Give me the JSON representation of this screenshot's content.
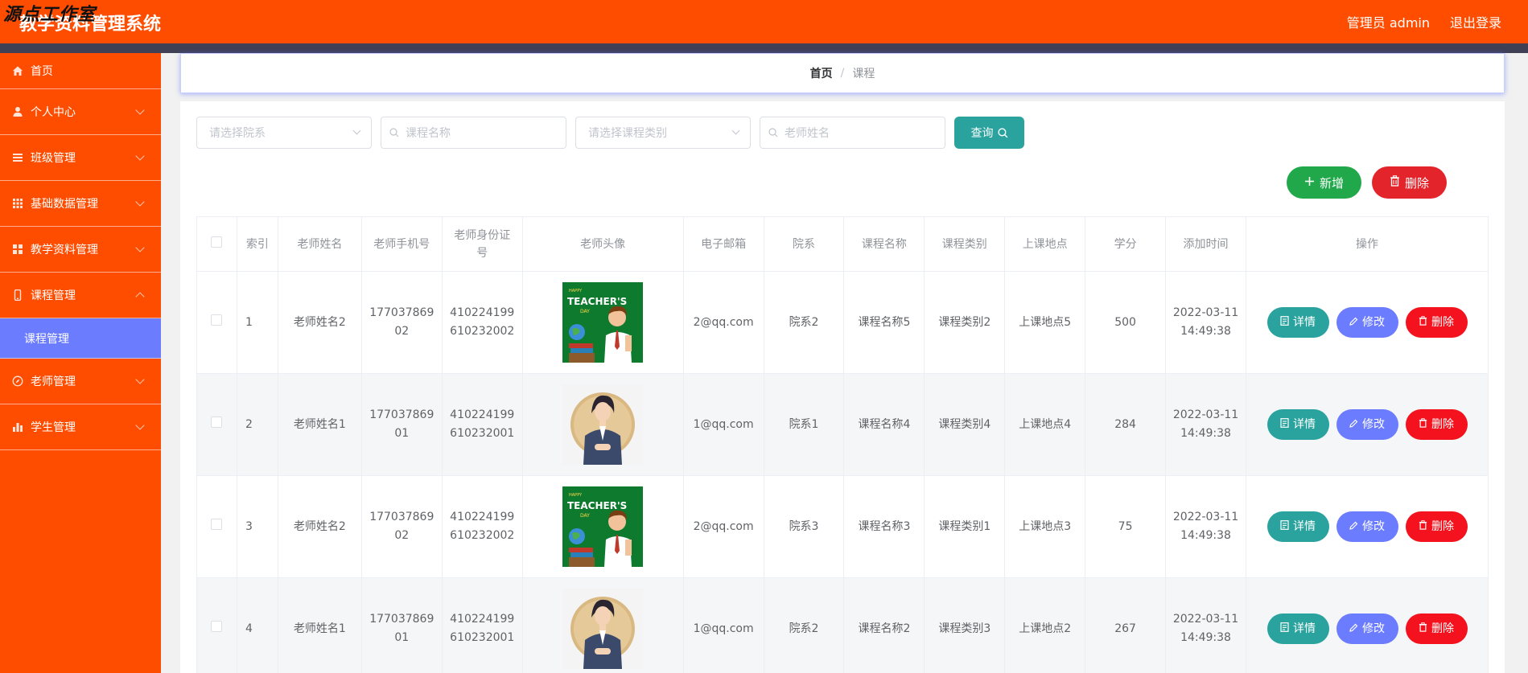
{
  "header": {
    "watermark": "源点工作室",
    "title": "教学资料管理系统",
    "user": "管理员 admin",
    "logout": "退出登录"
  },
  "sidebar": {
    "items": [
      {
        "label": "首页",
        "icon": "home-icon"
      },
      {
        "label": "个人中心",
        "icon": "user-icon"
      },
      {
        "label": "班级管理",
        "icon": "list-icon"
      },
      {
        "label": "基础数据管理",
        "icon": "grid-icon"
      },
      {
        "label": "教学资料管理",
        "icon": "apps-icon"
      },
      {
        "label": "课程管理",
        "icon": "phone-icon"
      },
      {
        "label": "老师管理",
        "icon": "compass-icon"
      },
      {
        "label": "学生管理",
        "icon": "bar-chart-icon"
      }
    ],
    "active_sub": "课程管理"
  },
  "breadcrumb": {
    "home": "首页",
    "separator": "/",
    "current": "课程"
  },
  "search": {
    "department_placeholder": "请选择院系",
    "course_name_placeholder": "课程名称",
    "course_type_placeholder": "请选择课程类别",
    "teacher_name_placeholder": "老师姓名",
    "query_label": "查询"
  },
  "actions": {
    "add_label": "新增",
    "delete_label": "删除"
  },
  "table": {
    "headers": [
      "索引",
      "老师姓名",
      "老师手机号",
      "老师身份证号",
      "老师头像",
      "电子邮箱",
      "院系",
      "课程名称",
      "课程类别",
      "上课地点",
      "学分",
      "添加时间",
      "操作"
    ],
    "header_id_lines": [
      "老师身份证",
      "号"
    ],
    "rows": [
      {
        "index": "1",
        "teacher": "老师姓名2",
        "phone_1": "177037869",
        "phone_2": "02",
        "id_1": "410224199",
        "id_2": "610232002",
        "avatar": "teachers-day-poster",
        "email": "2@qq.com",
        "dept": "院系2",
        "course": "课程名称5",
        "type": "课程类别2",
        "place": "上课地点5",
        "credit": "500",
        "date": "2022-03-11",
        "time": "14:49:38"
      },
      {
        "index": "2",
        "teacher": "老师姓名1",
        "phone_1": "177037869",
        "phone_2": "01",
        "id_1": "410224199",
        "id_2": "610232001",
        "avatar": "woman-teacher-portrait",
        "email": "1@qq.com",
        "dept": "院系1",
        "course": "课程名称4",
        "type": "课程类别4",
        "place": "上课地点4",
        "credit": "284",
        "date": "2022-03-11",
        "time": "14:49:38"
      },
      {
        "index": "3",
        "teacher": "老师姓名2",
        "phone_1": "177037869",
        "phone_2": "02",
        "id_1": "410224199",
        "id_2": "610232002",
        "avatar": "teachers-day-poster",
        "email": "2@qq.com",
        "dept": "院系3",
        "course": "课程名称3",
        "type": "课程类别1",
        "place": "上课地点3",
        "credit": "75",
        "date": "2022-03-11",
        "time": "14:49:38"
      },
      {
        "index": "4",
        "teacher": "老师姓名1",
        "phone_1": "177037869",
        "phone_2": "01",
        "id_1": "410224199",
        "id_2": "610232001",
        "avatar": "woman-teacher-portrait",
        "email": "1@qq.com",
        "dept": "院系2",
        "course": "课程名称2",
        "type": "课程类别3",
        "place": "上课地点2",
        "credit": "267",
        "date": "2022-03-11",
        "time": "14:49:38"
      }
    ],
    "row_actions": {
      "detail": "详情",
      "edit": "修改",
      "remove": "删除"
    }
  },
  "poster_text": {
    "happy": "HAPPY",
    "main_1": "TEACHER'S",
    "day": "DAY"
  },
  "colors": {
    "brand": "#ff4d00",
    "accent_teal": "#2aa39f",
    "accent_blue": "#6b7cff",
    "danger": "#f3121d",
    "success": "#20a84a"
  }
}
